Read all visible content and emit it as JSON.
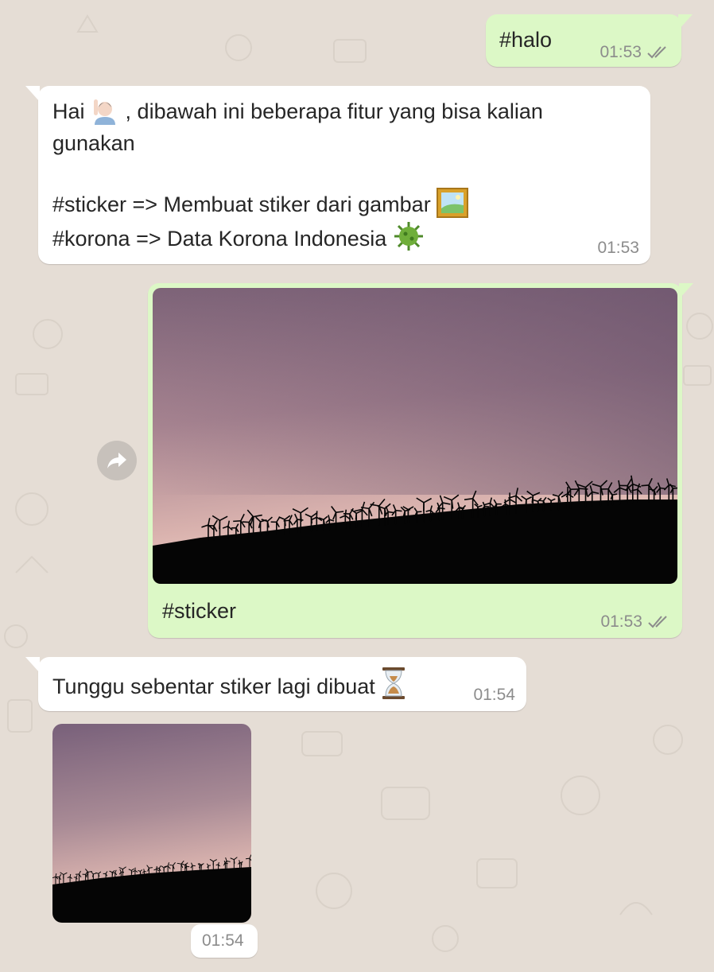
{
  "chat": {
    "messages": [
      {
        "direction": "out",
        "text": "#halo",
        "time": "01:53",
        "status": "read"
      },
      {
        "direction": "in",
        "greeting": "Hai",
        "greeting_emoji": "person-raising-hand",
        "greeting_rest": ", dibawah ini beberapa fitur yang bisa kalian",
        "line2": "gunakan",
        "feature1": "#sticker => Membuat stiker dari gambar",
        "feature1_emoji": "framed-picture",
        "feature2": "#korona => Data Korona Indonesia",
        "feature2_emoji": "microbe",
        "time": "01:53"
      },
      {
        "direction": "out",
        "type": "image",
        "image": "wind-turbines-sunset",
        "caption": "#sticker",
        "time": "01:53",
        "status": "read"
      },
      {
        "direction": "in",
        "text": "Tunggu sebentar stiker lagi dibuat",
        "emoji": "hourglass",
        "time": "01:54"
      },
      {
        "direction": "in",
        "type": "sticker",
        "image": "wind-turbines-sunset",
        "time": "01:54"
      }
    ]
  },
  "colors": {
    "background": "#e5ddd5",
    "outgoing_bubble": "#dcf8c6",
    "incoming_bubble": "#ffffff",
    "read_ticks": "#8c8c8c"
  },
  "icons": {
    "forward": "forward-icon",
    "double_check": "double-check-icon"
  }
}
